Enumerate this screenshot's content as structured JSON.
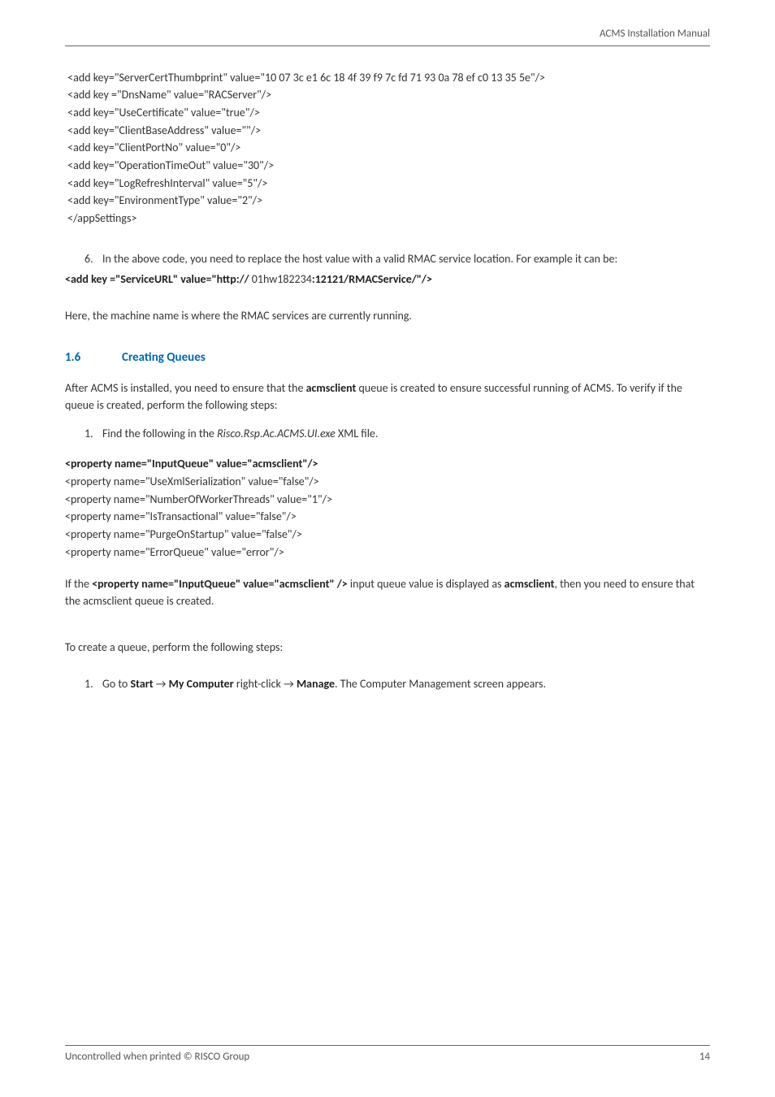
{
  "header": {
    "title": "ACMS Installation Manual"
  },
  "code1": {
    "l1": " <add key=\"ServerCertThumbprint\" value=\"10 07 3c e1 6c 18 4f 39 f9 7c fd 71 93 0a 78 ef c0 13 35 5e\"/>",
    "l2": " <add key =\"DnsName\" value=\"RACServer\"/>",
    "l3": " <add key=\"UseCertificate\" value=\"true\"/>",
    "l4": " <add key=\"ClientBaseAddress\" value=\"\"/>",
    "l5": " <add key=\"ClientPortNo\" value=\"0\"/>",
    "l6": " <add key=\"OperationTimeOut\" value=\"30\"/>",
    "l7": " <add key=\"LogRefreshInterval\" value=\"5\"/>",
    "l8": " <add key=\"EnvironmentType\" value=\"2\"/>",
    "l9": " </appSettings>"
  },
  "step6": {
    "num": "6.",
    "text": "In the above code, you need to replace the host value with a valid RMAC service location. For example it can be:"
  },
  "serviceLine": {
    "p1": "<add key =\"ServiceURL\" value=\"http:// ",
    "p2": "01hw182234",
    "p3": ":12121/RMACService/\"/>"
  },
  "paraAfter6": "Here, the machine name is where the RMAC services are currently running.",
  "section16": {
    "num": "1.6",
    "title": "Creating Queues"
  },
  "para16a_1": "After ACMS is installed, you need to ensure that the ",
  "para16a_bold": "acmsclient",
  "para16a_2": " queue is created to ensure successful running of ACMS. To verify if the queue is created, perform the following steps:",
  "step1q": {
    "num": "1.",
    "prefix": "Find the following in the ",
    "italic": "Risco.Rsp.Ac.ACMS.UI.exe",
    "suffix": " XML file."
  },
  "code2": {
    "bold": "<property name=\"InputQueue\" value=\"acmsclient\"/>",
    "l2": "<property name=\"UseXmlSerialization\" value=\"false\"/>",
    "l3": "<property name=\"NumberOfWorkerThreads\" value=\"1\"/>",
    "l4": "<property name=\"IsTransactional\" value=\"false\"/>",
    "l5": "<property name=\"PurgeOnStartup\" value=\"false\"/>",
    "l6": "<property name=\"ErrorQueue\" value=\"error\"/>"
  },
  "paraIf": {
    "p1": "If the ",
    "b1": "<property name=\"InputQueue\" value=\"acmsclient\" />",
    "p2": " input queue value is displayed as ",
    "b2": "acmsclient",
    "p3": ", then you need to ensure that the acmsclient queue is created."
  },
  "paraCreate": "To create a queue, perform the following steps:",
  "step1c": {
    "num": "1.",
    "p1": "Go to ",
    "b1": "Start",
    "arrow": " → ",
    "b2": "My Computer",
    "p2": " right-click ",
    "b3": "Manage",
    "p3": ". The Computer Management screen appears."
  },
  "footer": {
    "left": "Uncontrolled when printed © RISCO Group",
    "right": "14"
  }
}
